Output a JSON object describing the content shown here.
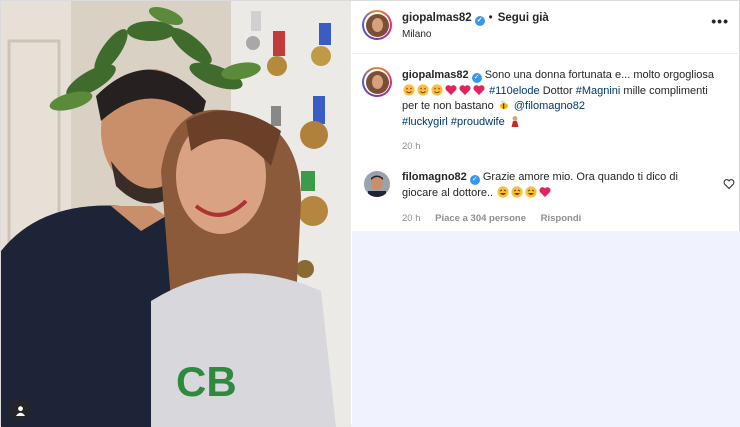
{
  "header": {
    "username": "giopalmas82",
    "separator": "•",
    "follow_label": "Segui già",
    "location": "Milano",
    "more_label": "•••"
  },
  "caption": {
    "username": "giopalmas82",
    "text_1": "Sono una donna fortunata e... molto orgogliosa",
    "hashtag_1": "#110elode",
    "text_2": " Dottor ",
    "hashtag_2": "#Magnini",
    "text_3": " mille complimenti per te non bastano",
    "mention": "@filomagno82",
    "hashtag_3": "#luckygirl",
    "hashtag_4": "#proudwife",
    "time": "20 h"
  },
  "reply": {
    "username": "filomagno82",
    "text": "Grazie amore mio. Ora quando ti dico di giocare al dottore..",
    "time": "20 h",
    "likes": "Piace a 304 persone",
    "reply_label": "Rispondi"
  },
  "colors": {
    "link": "#00376b",
    "verified": "#3897f0",
    "muted": "#8e8e8e",
    "heart_red": "#ed4956",
    "panel_bg": "#f0f3fd"
  },
  "icons": [
    "verified-badge-icon",
    "more-options-icon",
    "heart-outline-icon",
    "user-tag-icon"
  ]
}
